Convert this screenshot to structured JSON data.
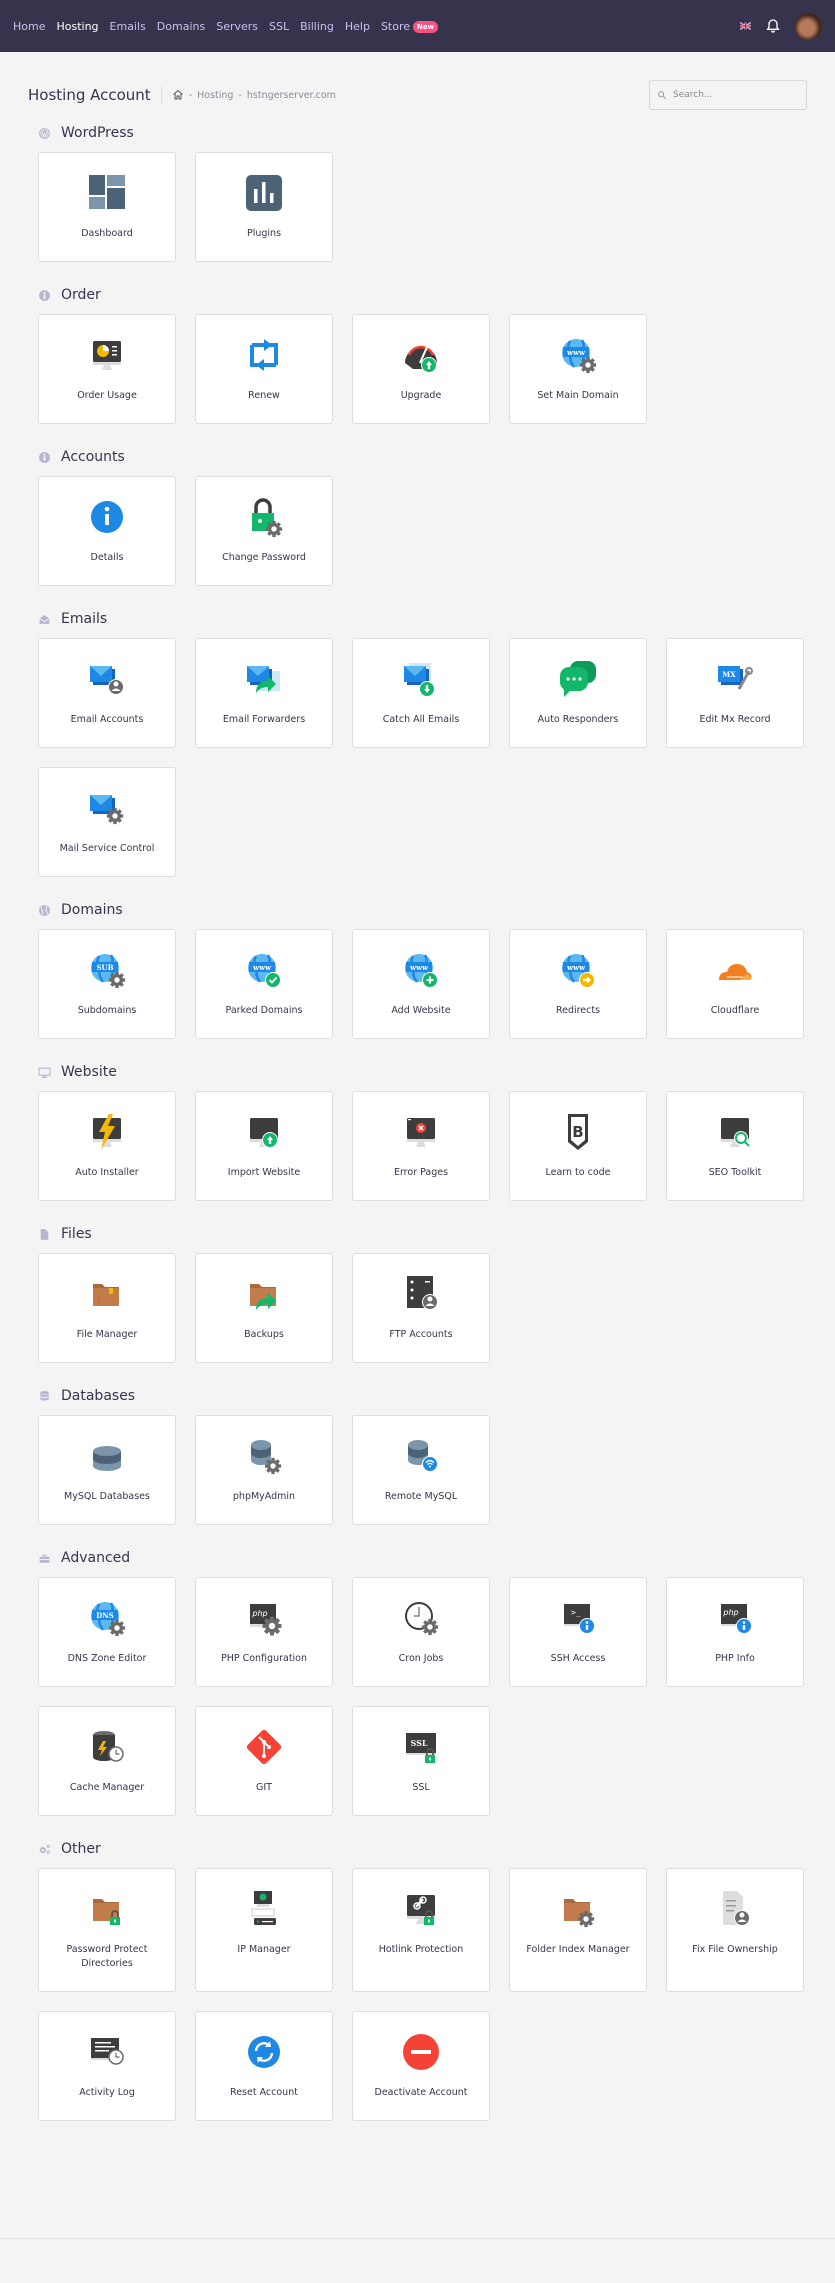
{
  "nav": {
    "items": [
      {
        "label": "Home",
        "active": false
      },
      {
        "label": "Hosting",
        "active": true
      },
      {
        "label": "Emails",
        "active": false
      },
      {
        "label": "Domains",
        "active": false
      },
      {
        "label": "Servers",
        "active": false
      },
      {
        "label": "SSL",
        "active": false
      },
      {
        "label": "Billing",
        "active": false
      },
      {
        "label": "Help",
        "active": false
      },
      {
        "label": "Store",
        "active": false
      }
    ],
    "store_badge": "New",
    "language_icon": "uk-flag-icon",
    "notifications_icon": "bell-icon",
    "avatar_icon": "user-avatar"
  },
  "header": {
    "title": "Hosting Account",
    "breadcrumb": {
      "home_icon": "home-icon",
      "separator": "-",
      "items": [
        "Hosting",
        "hstngerserver.com"
      ]
    },
    "search": {
      "placeholder": "Search...",
      "value": ""
    }
  },
  "sections": [
    {
      "title": "WordPress",
      "icon": "wordpress-icon",
      "items": [
        {
          "label": "Dashboard",
          "icon": "dashboard-icon"
        },
        {
          "label": "Plugins",
          "icon": "plugins-icon"
        }
      ]
    },
    {
      "title": "Order",
      "icon": "info-icon",
      "items": [
        {
          "label": "Order Usage",
          "icon": "order-usage-icon"
        },
        {
          "label": "Renew",
          "icon": "renew-icon"
        },
        {
          "label": "Upgrade",
          "icon": "upgrade-icon"
        },
        {
          "label": "Set Main Domain",
          "icon": "set-main-domain-icon"
        }
      ]
    },
    {
      "title": "Accounts",
      "icon": "info-icon",
      "items": [
        {
          "label": "Details",
          "icon": "details-icon"
        },
        {
          "label": "Change Password",
          "icon": "change-password-icon"
        }
      ]
    },
    {
      "title": "Emails",
      "icon": "envelope-open-icon",
      "items": [
        {
          "label": "Email Accounts",
          "icon": "email-accounts-icon"
        },
        {
          "label": "Email Forwarders",
          "icon": "email-forwarders-icon"
        },
        {
          "label": "Catch All Emails",
          "icon": "catch-all-emails-icon"
        },
        {
          "label": "Auto Responders",
          "icon": "auto-responders-icon"
        },
        {
          "label": "Edit Mx Record",
          "icon": "edit-mx-record-icon"
        },
        {
          "label": "Mail Service Control",
          "icon": "mail-service-control-icon"
        }
      ]
    },
    {
      "title": "Domains",
      "icon": "globe-icon",
      "items": [
        {
          "label": "Subdomains",
          "icon": "subdomains-icon"
        },
        {
          "label": "Parked Domains",
          "icon": "parked-domains-icon"
        },
        {
          "label": "Add Website",
          "icon": "add-website-icon"
        },
        {
          "label": "Redirects",
          "icon": "redirects-icon"
        },
        {
          "label": "Cloudflare",
          "icon": "cloudflare-icon"
        }
      ]
    },
    {
      "title": "Website",
      "icon": "monitor-icon",
      "items": [
        {
          "label": "Auto Installer",
          "icon": "auto-installer-icon"
        },
        {
          "label": "Import Website",
          "icon": "import-website-icon"
        },
        {
          "label": "Error Pages",
          "icon": "error-pages-icon"
        },
        {
          "label": "Learn to code",
          "icon": "learn-to-code-icon"
        },
        {
          "label": "SEO Toolkit",
          "icon": "seo-toolkit-icon"
        }
      ]
    },
    {
      "title": "Files",
      "icon": "file-icon",
      "items": [
        {
          "label": "File Manager",
          "icon": "file-manager-icon"
        },
        {
          "label": "Backups",
          "icon": "backups-icon"
        },
        {
          "label": "FTP Accounts",
          "icon": "ftp-accounts-icon"
        }
      ]
    },
    {
      "title": "Databases",
      "icon": "database-icon",
      "items": [
        {
          "label": "MySQL Databases",
          "icon": "mysql-databases-icon"
        },
        {
          "label": "phpMyAdmin",
          "icon": "phpmyadmin-icon"
        },
        {
          "label": "Remote MySQL",
          "icon": "remote-mysql-icon"
        }
      ]
    },
    {
      "title": "Advanced",
      "icon": "toolbox-icon",
      "items": [
        {
          "label": "DNS Zone Editor",
          "icon": "dns-zone-editor-icon"
        },
        {
          "label": "PHP Configuration",
          "icon": "php-configuration-icon"
        },
        {
          "label": "Cron Jobs",
          "icon": "cron-jobs-icon"
        },
        {
          "label": "SSH Access",
          "icon": "ssh-access-icon"
        },
        {
          "label": "PHP Info",
          "icon": "php-info-icon"
        },
        {
          "label": "Cache Manager",
          "icon": "cache-manager-icon"
        },
        {
          "label": "GIT",
          "icon": "git-icon"
        },
        {
          "label": "SSL",
          "icon": "ssl-icon"
        }
      ]
    },
    {
      "title": "Other",
      "icon": "gears-icon",
      "items": [
        {
          "label": "Password Protect Directories",
          "icon": "password-protect-directories-icon"
        },
        {
          "label": "IP Manager",
          "icon": "ip-manager-icon"
        },
        {
          "label": "Hotlink Protection",
          "icon": "hotlink-protection-icon"
        },
        {
          "label": "Folder Index Manager",
          "icon": "folder-index-manager-icon"
        },
        {
          "label": "Fix File Ownership",
          "icon": "fix-file-ownership-icon"
        },
        {
          "label": "Activity Log",
          "icon": "activity-log-icon"
        },
        {
          "label": "Reset Account",
          "icon": "reset-account-icon"
        },
        {
          "label": "Deactivate Account",
          "icon": "deactivate-account-icon"
        }
      ]
    }
  ],
  "colors": {
    "nav_bg": "#36344d",
    "nav_link": "#c7c2f0",
    "badge": "#fc5185",
    "page_bg": "#f4f4f4",
    "blue": "#1e88e5",
    "green": "#12b76a",
    "red": "#f44336",
    "slate": "#4c6277",
    "brown": "#c27c4c",
    "orange": "#f38020"
  }
}
